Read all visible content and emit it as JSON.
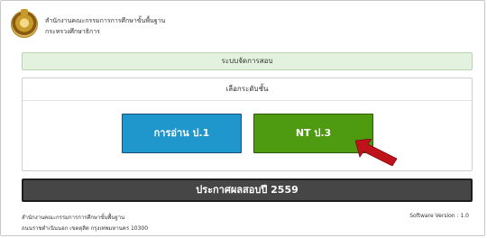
{
  "header": {
    "org_line1": "สำนักงานคณะกรรมการการศึกษาขั้นพื้นฐาน",
    "org_line2": "กระทรวงศึกษาธิการ"
  },
  "title_bar": {
    "label": "ระบบจัดการสอบ"
  },
  "panel": {
    "heading": "เลือกระดับชั้น",
    "buttons": [
      {
        "label": "การอ่าน ป.1",
        "color": "#1f96cc"
      },
      {
        "label": "NT ป.3",
        "color": "#4e9a10"
      }
    ]
  },
  "arrow": {
    "icon": "red-arrow-pointer-icon",
    "color": "#c0121b"
  },
  "announce": {
    "label": "ประกาศผลสอบปี 2559"
  },
  "footer": {
    "left_line1": "สำนักงานคณะกรรมการการศึกษาขั้นพื้นฐาน",
    "left_line2": "ถนนราชดำเนินนอก เขตดุสิต กรุงเทพมหานคร 10300",
    "version": "Software Version : 1.0"
  }
}
